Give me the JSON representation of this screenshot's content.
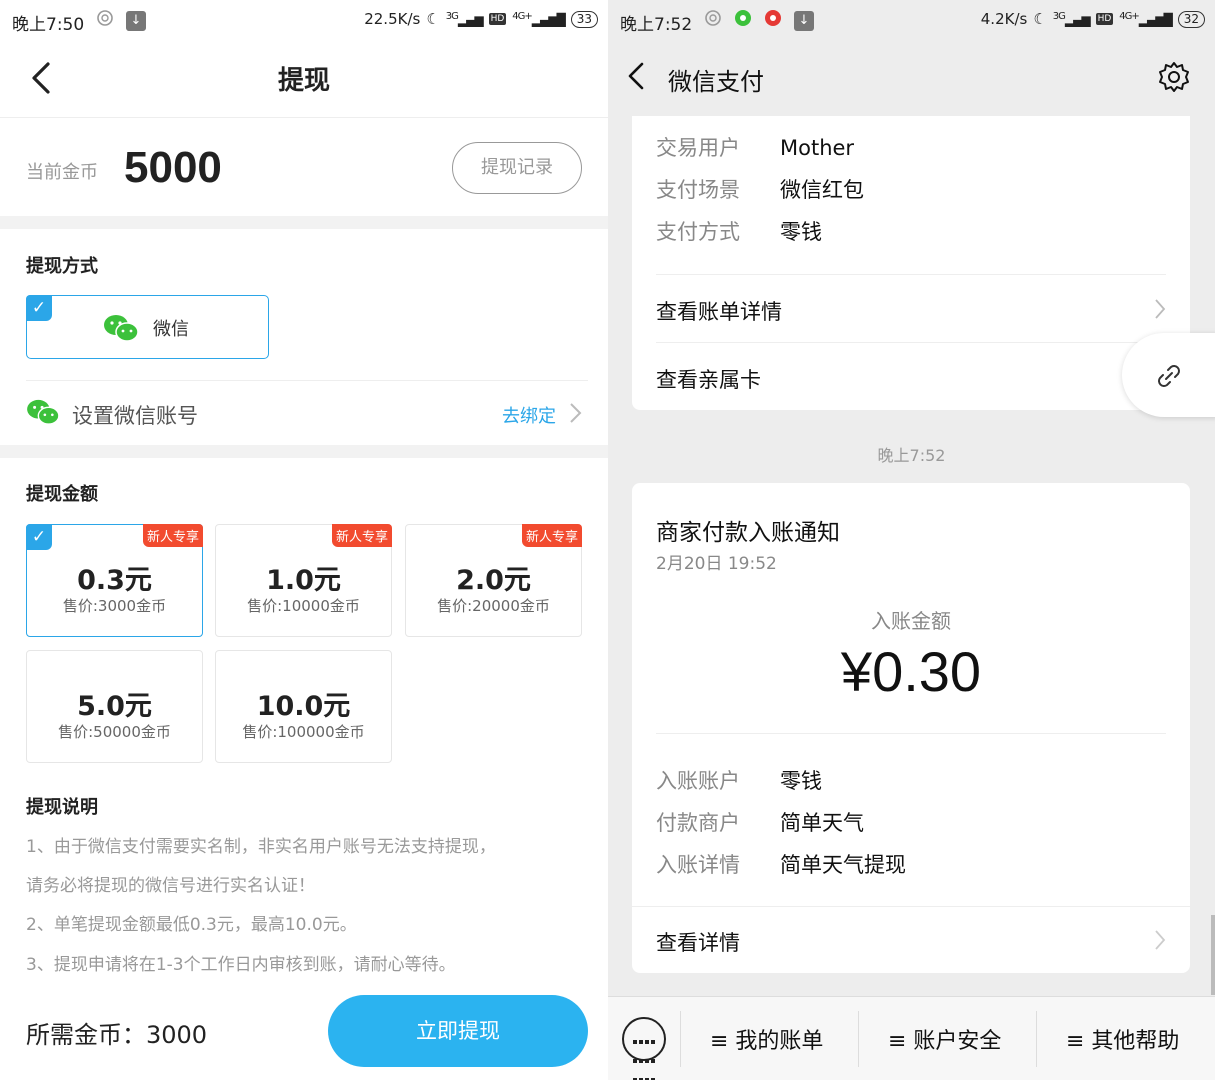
{
  "left_status": {
    "time": "晚上7:50",
    "speed": "22.5K/s",
    "net1": "3G",
    "hd": "HD",
    "net2": "4G+",
    "battery": "33"
  },
  "withdraw": {
    "title": "提现",
    "coins_label": "当前金币",
    "coins_value": "5000",
    "records_button": "提现记录",
    "method_title": "提现方式",
    "method_wechat": "微信",
    "bind_label": "设置微信账号",
    "bind_action": "去绑定",
    "amount_title": "提现金额",
    "amounts": [
      {
        "value": "0.3元",
        "price": "售价:3000金币",
        "tag": "新人专享",
        "selected": true
      },
      {
        "value": "1.0元",
        "price": "售价:10000金币",
        "tag": "新人专享",
        "selected": false
      },
      {
        "value": "2.0元",
        "price": "售价:20000金币",
        "tag": "新人专享",
        "selected": false
      },
      {
        "value": "5.0元",
        "price": "售价:50000金币",
        "tag": "",
        "selected": false
      },
      {
        "value": "10.0元",
        "price": "售价:100000金币",
        "tag": "",
        "selected": false
      }
    ],
    "notes_title": "提现说明",
    "notes": [
      "1、由于微信支付需要实名制，非实名用户账号无法支持提现，",
      "请务必将提现的微信号进行实名认证！",
      "2、单笔提现金额最低0.3元，最高10.0元。",
      "3、提现申请将在1-3个工作日内审核到账，请耐心等待。"
    ],
    "need_coins": "所需金币：3000",
    "submit_button": "立即提现"
  },
  "right_status": {
    "time": "晚上7:52",
    "speed": "4.2K/s",
    "net1": "3G",
    "hd": "HD",
    "net2": "4G+",
    "battery": "32"
  },
  "wechat_pay": {
    "title": "微信支付",
    "card1": {
      "rows": [
        {
          "key": "交易用户",
          "value": "Mother"
        },
        {
          "key": "支付场景",
          "value": "微信红包"
        },
        {
          "key": "支付方式",
          "value": "零钱"
        }
      ],
      "link_bill": "查看账单详情",
      "link_family": "查看亲属卡"
    },
    "timestamp": "晚上7:52",
    "card2": {
      "title": "商家付款入账通知",
      "date": "2月20日 19:52",
      "amount_label": "入账金额",
      "amount": "¥0.30",
      "rows": [
        {
          "key": "入账账户",
          "value": "零钱"
        },
        {
          "key": "付款商户",
          "value": "简单天气"
        },
        {
          "key": "入账详情",
          "value": "简单天气提现"
        }
      ],
      "link_details": "查看详情"
    },
    "menu": [
      "≡ 我的账单",
      "≡ 账户安全",
      "≡ 其他帮助"
    ]
  },
  "colors": {
    "accent": "#2ba6e8",
    "tag_red": "#f24b2f",
    "wechat_green": "#3cc13b"
  }
}
